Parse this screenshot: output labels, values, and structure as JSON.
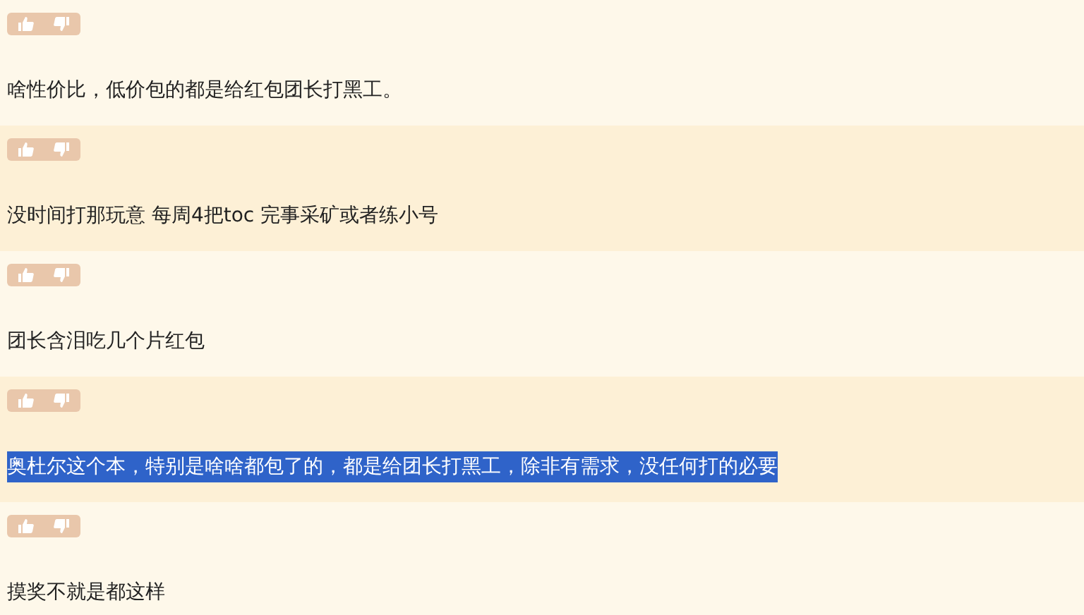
{
  "comments": [
    {
      "text": "啥性价比，低价包的都是给红包团长打黑工。",
      "selected": false
    },
    {
      "text": "没时间打那玩意 每周4把toc 完事采矿或者练小号",
      "selected": false
    },
    {
      "text": "团长含泪吃几个片红包",
      "selected": false
    },
    {
      "text": "奥杜尔这个本，特别是啥啥都包了的，都是给团长打黑工，除非有需求，没任何打的必要",
      "selected": true
    },
    {
      "text": "摸奖不就是都这样",
      "selected": false
    }
  ]
}
